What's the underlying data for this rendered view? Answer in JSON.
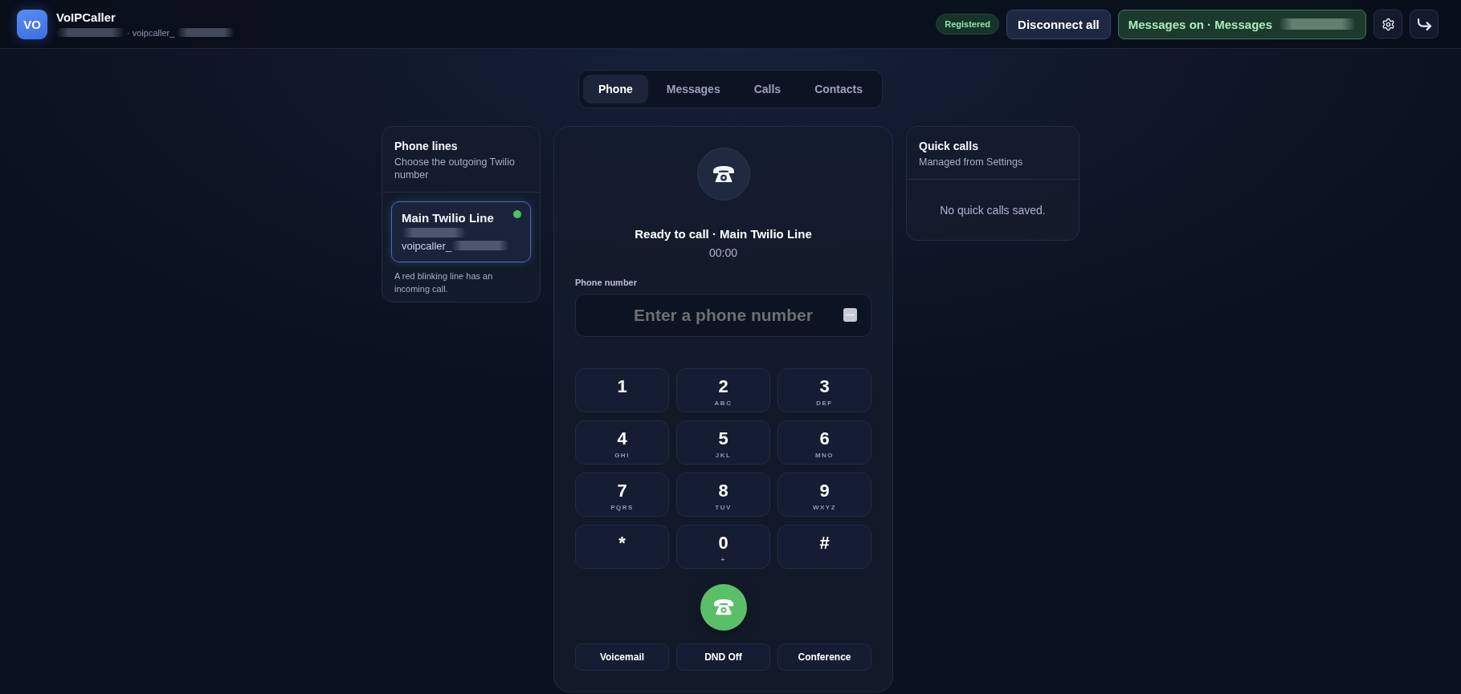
{
  "header": {
    "logo": "VO",
    "title": "VoIPCaller",
    "subtitle": [
      {
        "kind": "redacted"
      },
      {
        "kind": "text",
        "text": "· voipcaller_"
      },
      {
        "kind": "redacted"
      }
    ],
    "registration": {
      "label": "Registered",
      "registered": true
    },
    "disconnect_button": "Disconnect all",
    "messages_toggle": {
      "on": true,
      "segments": [
        {
          "kind": "text",
          "text": "Messages on · Messages"
        },
        {
          "kind": "redacted"
        }
      ]
    }
  },
  "tabs": [
    {
      "label": "Phone",
      "selected": true
    },
    {
      "label": "Messages",
      "selected": false
    },
    {
      "label": "Calls",
      "selected": false
    },
    {
      "label": "Contacts",
      "selected": false
    }
  ],
  "phone_lines": {
    "title": "Phone lines",
    "subtitle": "Choose the outgoing Twilio number",
    "lines": [
      {
        "name": "Main Twilio Line",
        "selected": true,
        "color": "#4cc35d",
        "details": [
          [
            {
              "kind": "redacted"
            }
          ],
          [
            {
              "kind": "text",
              "text": "voipcaller_"
            },
            {
              "kind": "redacted"
            }
          ]
        ]
      }
    ],
    "note": "A red blinking line has an incoming call."
  },
  "dialer": {
    "status": "Ready to call · Main Twilio Line",
    "timer": "00:00",
    "number_field": {
      "label": "Phone number",
      "placeholder": "Enter a phone number"
    },
    "keys": [
      {
        "digit": "1"
      },
      {
        "digit": "2",
        "letters": "ABC"
      },
      {
        "digit": "3",
        "letters": "DEF"
      },
      {
        "digit": "4",
        "letters": "GHI"
      },
      {
        "digit": "5",
        "letters": "JKL"
      },
      {
        "digit": "6",
        "letters": "MNO"
      },
      {
        "digit": "7",
        "letters": "PQRS"
      },
      {
        "digit": "8",
        "letters": "TUV"
      },
      {
        "digit": "9",
        "letters": "WXYZ"
      },
      {
        "digit": "*"
      },
      {
        "digit": "0",
        "letters": "+"
      },
      {
        "digit": "#"
      }
    ],
    "actions": [
      "Voicemail",
      "DND Off",
      "Conference"
    ]
  },
  "quick_calls": {
    "title": "Quick calls",
    "subtitle": "Managed from Settings",
    "empty_text": "No quick calls saved."
  }
}
